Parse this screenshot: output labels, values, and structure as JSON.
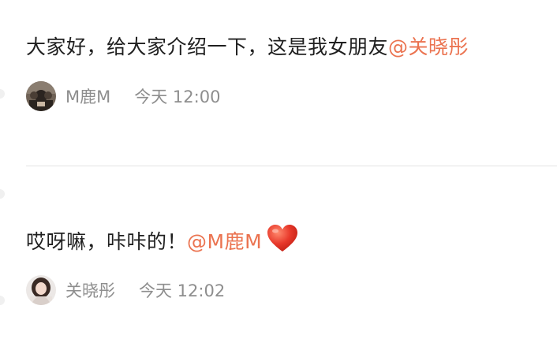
{
  "comments": [
    {
      "text": "大家好，给大家介绍一下，这是我女朋友",
      "mention": "@关晓彤",
      "username": "M鹿M",
      "time": "今天 12:00"
    },
    {
      "text": "哎呀嘛，咔咔的！",
      "mention": "@M鹿M",
      "emoji": "heart-icon",
      "username": "关晓彤",
      "time": "今天 12:02"
    }
  ],
  "colors": {
    "mention": "#eb7350",
    "meta_text": "#8e8e8e",
    "body_text": "#1f1f1f",
    "heart": "#e8392b",
    "divider": "#e3e3e3"
  }
}
